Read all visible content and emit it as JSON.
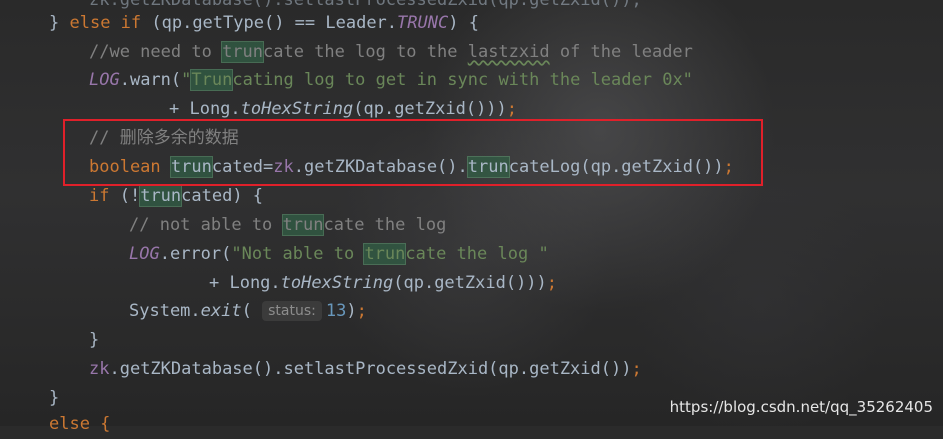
{
  "editor": {
    "lines": [
      {
        "text": "        zk.getZKDatabase().setlastProcessedZxid(qp.getZxid());"
      },
      {
        "text": "} else if (qp.getType() == Leader.TRUNC) {"
      },
      {
        "text": "    //we need to truncate the log to the lastzxid of the leader"
      },
      {
        "text": "    LOG.warn(\"Truncating log to get in sync with the leader 0x\""
      },
      {
        "text": "            + Long.toHexString(qp.getZxid()));"
      },
      {
        "text": "    // 删除多余的数据"
      },
      {
        "text": "    boolean truncated=zk.getZKDatabase().truncateLog(qp.getZxid());"
      },
      {
        "text": "    if (!truncated) {"
      },
      {
        "text": "        // not able to truncate the log"
      },
      {
        "text": "        LOG.error(\"Not able to truncate the log \""
      },
      {
        "text": "                + Long.toHexString(qp.getZxid()));"
      },
      {
        "text": "        System.exit( status: 13);"
      },
      {
        "text": "    }"
      },
      {
        "text": "    zk.getZKDatabase().setlastProcessedZxid(qp.getZxid());"
      },
      {
        "text": "}"
      },
      {
        "text": "else {"
      }
    ],
    "tokens": {
      "kw_else": "else",
      "kw_if": "if",
      "kw_boolean": "boolean",
      "kw_else_open": "else {",
      "log": "LOG",
      "trunc_const": "TRUNC",
      "leader": "Leader",
      "str_warn": "\"Truncating log to get in sync with the leader 0x\"",
      "str_error": "\"Not able to truncate the log \"",
      "comment_need": "//we need to truncate the log to the lastzxid of the leader",
      "comment_cn": "// 删除多余的数据",
      "comment_not_able": "// not able to truncate the log",
      "hint_status": "status:",
      "num_13": "13",
      "zk": "zk",
      "to_hex": "toHexString",
      "exit": "exit"
    }
  },
  "watermark": "https://blog.csdn.net/qq_35262405",
  "colors": {
    "keyword": "#cc7832",
    "field": "#9876aa",
    "string": "#6a8759",
    "number": "#6897bb",
    "comment": "#808080",
    "text": "#a9b7c6",
    "highlight_box": "#e0202a"
  }
}
